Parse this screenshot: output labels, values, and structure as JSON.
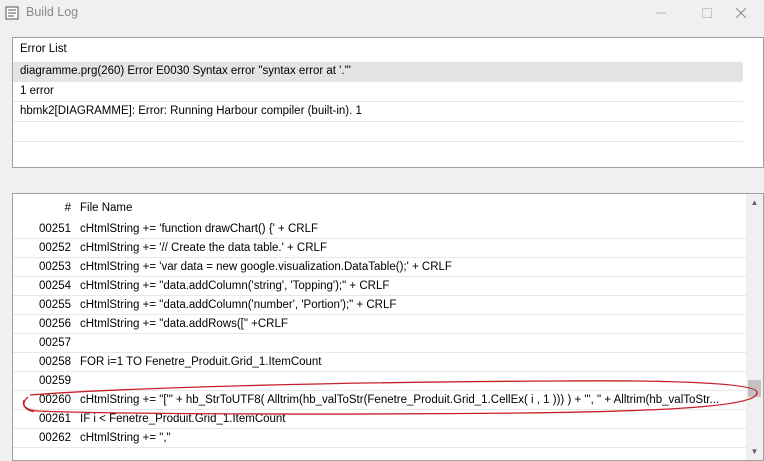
{
  "window": {
    "title": "Build Log"
  },
  "error_list": {
    "header": "Error List",
    "rows": [
      "diagramme.prg(260) Error E0030  Syntax error \"syntax error at '.'\"",
      "1 error",
      "hbmk2[DIAGRAMME]: Error: Running Harbour compiler (built-in). 1"
    ],
    "selected_index": 0
  },
  "log": {
    "columns": {
      "number": "#",
      "file_name": "File Name"
    },
    "rows": [
      {
        "num": "00251",
        "text": "cHtmlString += 'function drawChart() {' + CRLF"
      },
      {
        "num": "00252",
        "text": "cHtmlString += '// Create the data table.' + CRLF"
      },
      {
        "num": "00253",
        "text": "cHtmlString += 'var data = new google.visualization.DataTable();' + CRLF"
      },
      {
        "num": "00254",
        "text": "cHtmlString += \"data.addColumn('string', 'Topping');\" + CRLF"
      },
      {
        "num": "00255",
        "text": "cHtmlString += \"data.addColumn('number', 'Portion');\" + CRLF"
      },
      {
        "num": "00256",
        "text": "cHtmlString += \"data.addRows([\" +CRLF"
      },
      {
        "num": "00257",
        "text": ""
      },
      {
        "num": "00258",
        "text": "FOR i=1 TO Fenetre_Produit.Grid_1.ItemCount"
      },
      {
        "num": "00259",
        "text": ""
      },
      {
        "num": "00260",
        "text": "cHtmlString += \"['\" + hb_StrToUTF8( Alltrim(hb_valToStr(Fenetre_Produit.Grid_1.CellEx( i , 1 ))) ) + \"', \" + Alltrim(hb_valToStr..."
      },
      {
        "num": "00261",
        "text": "IF i < Fenetre_Produit.Grid_1.ItemCount"
      },
      {
        "num": "00262",
        "text": "cHtmlString += \",\""
      }
    ]
  },
  "annotation": {
    "color": "#c8202a",
    "highlighted_line": "00260"
  }
}
